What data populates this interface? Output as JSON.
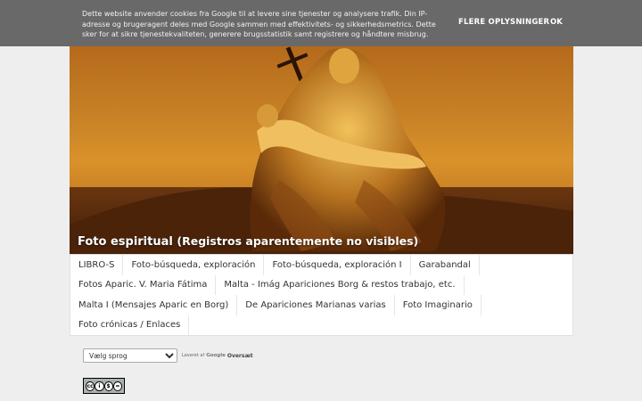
{
  "cookie_notice": {
    "text": "Dette website anvender cookies fra Google til at levere sine tjenester og analysere trafik. Din IP-adresse og brugeragent deles med Google sammen med effektivitets- og sikkerhedsmetrics. Dette sker for at sikre tjenestekvaliteten, generere brugsstatistik samt registrere og håndtere misbrug.",
    "more_label": "FLERE OPLYSNINGER",
    "ok_label": "OK"
  },
  "header": {
    "caption_main": "Foto espiritual",
    "caption_sub": "(Registros aparentemente no visibles)"
  },
  "nav": {
    "rows": [
      [
        "LIBRO-S",
        "Foto-búsqueda, exploración",
        "Foto-búsqueda, exploración I",
        "Garabandal"
      ],
      [
        "Fotos Aparic. V. Maria Fátima",
        "Malta - Imág Apariciones Borg & restos trabajo, etc."
      ],
      [
        "Malta I (Mensajes Aparic en Borg)",
        "De Apariciones Marianas varias",
        "Foto Imaginario"
      ],
      [
        "Foto crónicas / Enlaces"
      ]
    ]
  },
  "translate": {
    "select_value": "Vælg sprog",
    "powered_prefix": "Leveret af",
    "google": "Google",
    "translate_label": "Oversæt"
  },
  "license_badge": {
    "icons": [
      "cc",
      "by",
      "nc",
      "nd"
    ]
  },
  "colors": {
    "cookie_bg": "#646464",
    "page_bg": "#eeeeee",
    "nav_bg": "#ffffff",
    "header_gold": "#d9922a"
  }
}
